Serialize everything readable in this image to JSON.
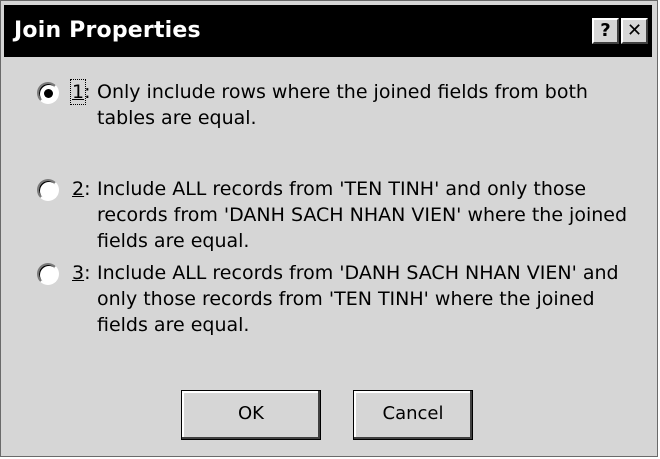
{
  "window": {
    "title": "Join Properties",
    "help_label": "?",
    "close_label": "✕"
  },
  "options": [
    {
      "key": "1",
      "sep": ":",
      "lines": [
        "Only include rows where the joined fields from both",
        "tables are equal."
      ],
      "selected": true
    },
    {
      "key": "2",
      "sep": ":",
      "lines": [
        "Include ALL records from 'TEN TINH' and only those",
        "records from 'DANH SACH NHAN VIEN' where the joined",
        "fields are equal."
      ],
      "selected": false
    },
    {
      "key": "3",
      "sep": ":",
      "lines": [
        "Include ALL records from 'DANH SACH NHAN VIEN' and",
        "only those records from 'TEN TINH' where the joined",
        "fields are equal."
      ],
      "selected": false
    }
  ],
  "buttons": {
    "ok_label": "OK",
    "cancel_label": "Cancel"
  }
}
